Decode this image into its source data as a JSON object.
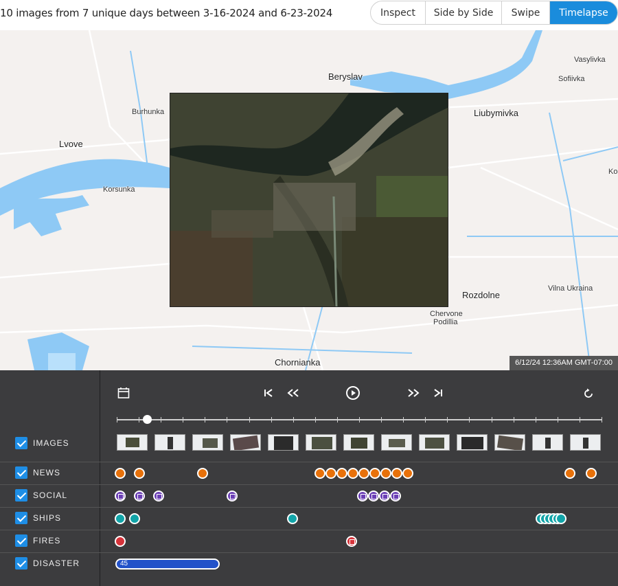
{
  "header": {
    "summary": "10 images from 7 unique days between 3-16-2024 and 6-23-2024",
    "modes": [
      "Inspect",
      "Side by Side",
      "Swipe",
      "Timelapse"
    ],
    "active_mode": "Timelapse"
  },
  "map": {
    "places": [
      "Beryslav",
      "Vasylivka",
      "Sofiivka",
      "Burhunka",
      "Liubymivka",
      "Lvove",
      "Korsunka",
      "Ko",
      "Rozdolne",
      "Vilna Ukraina",
      "Chervone",
      "Podillia",
      "Chornianka"
    ],
    "timestamp": "6/12/24 12:36AM GMT-07:00",
    "colors": {
      "water": "#8ec9f5",
      "land": "#f4f1ef",
      "road": "#ffffff"
    }
  },
  "timeline": {
    "controls": [
      "calendar-icon",
      "skip-start-icon",
      "rewind-icon",
      "play-icon",
      "fast-forward-icon",
      "skip-end-icon",
      "loop-icon"
    ],
    "slider_position": 0.063,
    "categories": [
      {
        "label": "IMAGES",
        "checked": true
      },
      {
        "label": "NEWS",
        "checked": true
      },
      {
        "label": "SOCIAL",
        "checked": true
      },
      {
        "label": "SHIPS",
        "checked": true
      },
      {
        "label": "FIRES",
        "checked": true
      },
      {
        "label": "DISASTER",
        "checked": true
      }
    ],
    "disaster_count": "45",
    "colors": {
      "news": "#e8710a",
      "social": "#6b3fb5",
      "ships": "#12a4a8",
      "fires": "#d6333a",
      "disaster": "#2352c9",
      "accent": "#1a8cdc"
    }
  }
}
